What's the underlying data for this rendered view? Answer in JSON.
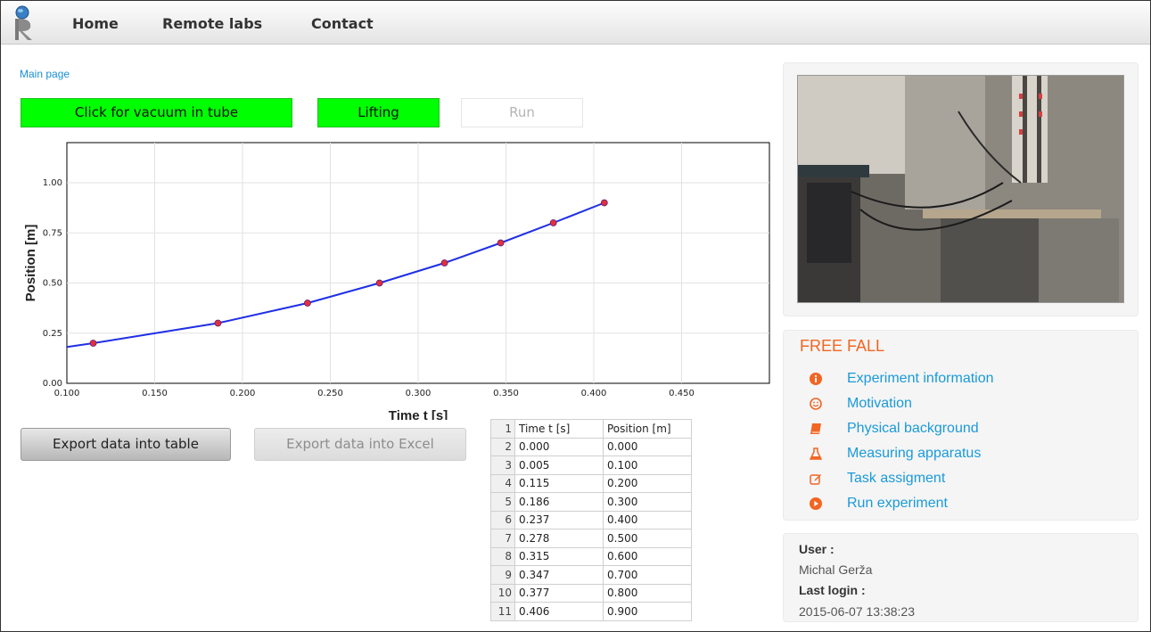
{
  "nav": {
    "home": "Home",
    "remote_labs": "Remote labs",
    "contact": "Contact"
  },
  "breadcrumb": "Main page",
  "controls": {
    "vacuum": "Click for vacuum in tube",
    "lifting": "Lifting",
    "run": "Run"
  },
  "export": {
    "table": "Export data into table",
    "excel": "Export data into Excel"
  },
  "chart_data": {
    "type": "line",
    "xlabel": "Time t [s]",
    "ylabel": "Position [m]",
    "xlim": [
      0.1,
      0.5
    ],
    "ylim": [
      0,
      1.2
    ],
    "xticks": [
      "0.100",
      "0.150",
      "0.200",
      "0.250",
      "0.300",
      "0.350",
      "0.400",
      "0.450"
    ],
    "yticks": [
      "0.00",
      "0.25",
      "0.50",
      "0.75",
      "1.00"
    ],
    "grid": true,
    "series": [
      {
        "color": "#1f2fe6",
        "marker_color": "#e0303f",
        "x": [
          0.115,
          0.186,
          0.237,
          0.278,
          0.315,
          0.347,
          0.377,
          0.406
        ],
        "y": [
          0.2,
          0.3,
          0.4,
          0.5,
          0.6,
          0.7,
          0.8,
          0.9
        ]
      }
    ]
  },
  "table": {
    "header": [
      "1",
      "Time t [s]",
      "Position [m]"
    ],
    "rows": [
      [
        "2",
        "0.000",
        "0.000"
      ],
      [
        "3",
        "0.005",
        "0.100"
      ],
      [
        "4",
        "0.115",
        "0.200"
      ],
      [
        "5",
        "0.186",
        "0.300"
      ],
      [
        "6",
        "0.237",
        "0.400"
      ],
      [
        "7",
        "0.278",
        "0.500"
      ],
      [
        "8",
        "0.315",
        "0.600"
      ],
      [
        "9",
        "0.347",
        "0.700"
      ],
      [
        "10",
        "0.377",
        "0.800"
      ],
      [
        "11",
        "0.406",
        "0.900"
      ]
    ]
  },
  "experiment": {
    "title": "FREE FALL",
    "menu": [
      {
        "label": "Experiment information",
        "icon": "info-icon"
      },
      {
        "label": "Motivation",
        "icon": "smile-icon"
      },
      {
        "label": "Physical background",
        "icon": "book-icon"
      },
      {
        "label": "Measuring apparatus",
        "icon": "flask-icon"
      },
      {
        "label": "Task assigment",
        "icon": "edit-icon"
      },
      {
        "label": "Run experiment",
        "icon": "play-icon"
      }
    ]
  },
  "user": {
    "user_label": "User :",
    "user_name": "Michal Gerža",
    "last_login_label": "Last login :",
    "last_login": "2015-06-07 13:38:23"
  },
  "colors": {
    "accent": "#f26522",
    "link": "#1a9ad9",
    "button_green": "#00ff00"
  }
}
